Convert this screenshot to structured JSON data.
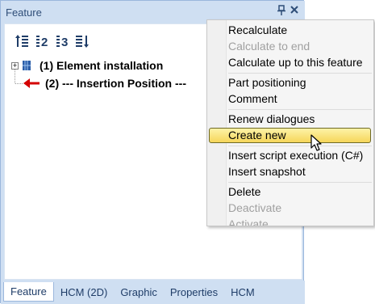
{
  "panel": {
    "title": "Feature",
    "pin_glyph": "⊥",
    "close_glyph": "✕"
  },
  "toolbar": {
    "buttons": [
      {
        "icon": "sort-up-icon",
        "label": ""
      },
      {
        "icon": "number-2-icon",
        "label": "2"
      },
      {
        "icon": "number-3-icon",
        "label": "3"
      },
      {
        "icon": "sort-down-icon",
        "label": ""
      }
    ]
  },
  "tree": {
    "items": [
      {
        "label": "(1) Element installation",
        "icon": "element-installation-icon",
        "expander": "+"
      },
      {
        "label": "(2) --- Insertion Position ---",
        "icon": "red-arrow-left-icon"
      }
    ]
  },
  "tabs": [
    {
      "label": "Feature",
      "active": true
    },
    {
      "label": "HCM (2D)",
      "active": false
    },
    {
      "label": "Graphic",
      "active": false
    },
    {
      "label": "Properties",
      "active": false
    },
    {
      "label": "HCM",
      "active": false
    }
  ],
  "context_menu": {
    "items": [
      {
        "label": "Recalculate",
        "enabled": true
      },
      {
        "label": "Calculate to end",
        "enabled": false
      },
      {
        "label": "Calculate up to this feature",
        "enabled": true
      },
      {
        "label": "Part positioning",
        "enabled": true
      },
      {
        "label": "Comment",
        "enabled": true
      },
      {
        "label": "Renew dialogues",
        "enabled": true
      },
      {
        "label": "Create new",
        "enabled": true,
        "highlighted": true
      },
      {
        "label": "Insert script execution (C#)",
        "enabled": true
      },
      {
        "label": "Insert snapshot",
        "enabled": true
      },
      {
        "label": "Delete",
        "enabled": true
      },
      {
        "label": "Deactivate",
        "enabled": false
      },
      {
        "label": "Activate",
        "enabled": false
      }
    ]
  },
  "colors": {
    "panel_bg": "#cfdff2",
    "title_text": "#2f4e78",
    "highlight": "#f6d65a",
    "arrow_red": "#d40000"
  }
}
